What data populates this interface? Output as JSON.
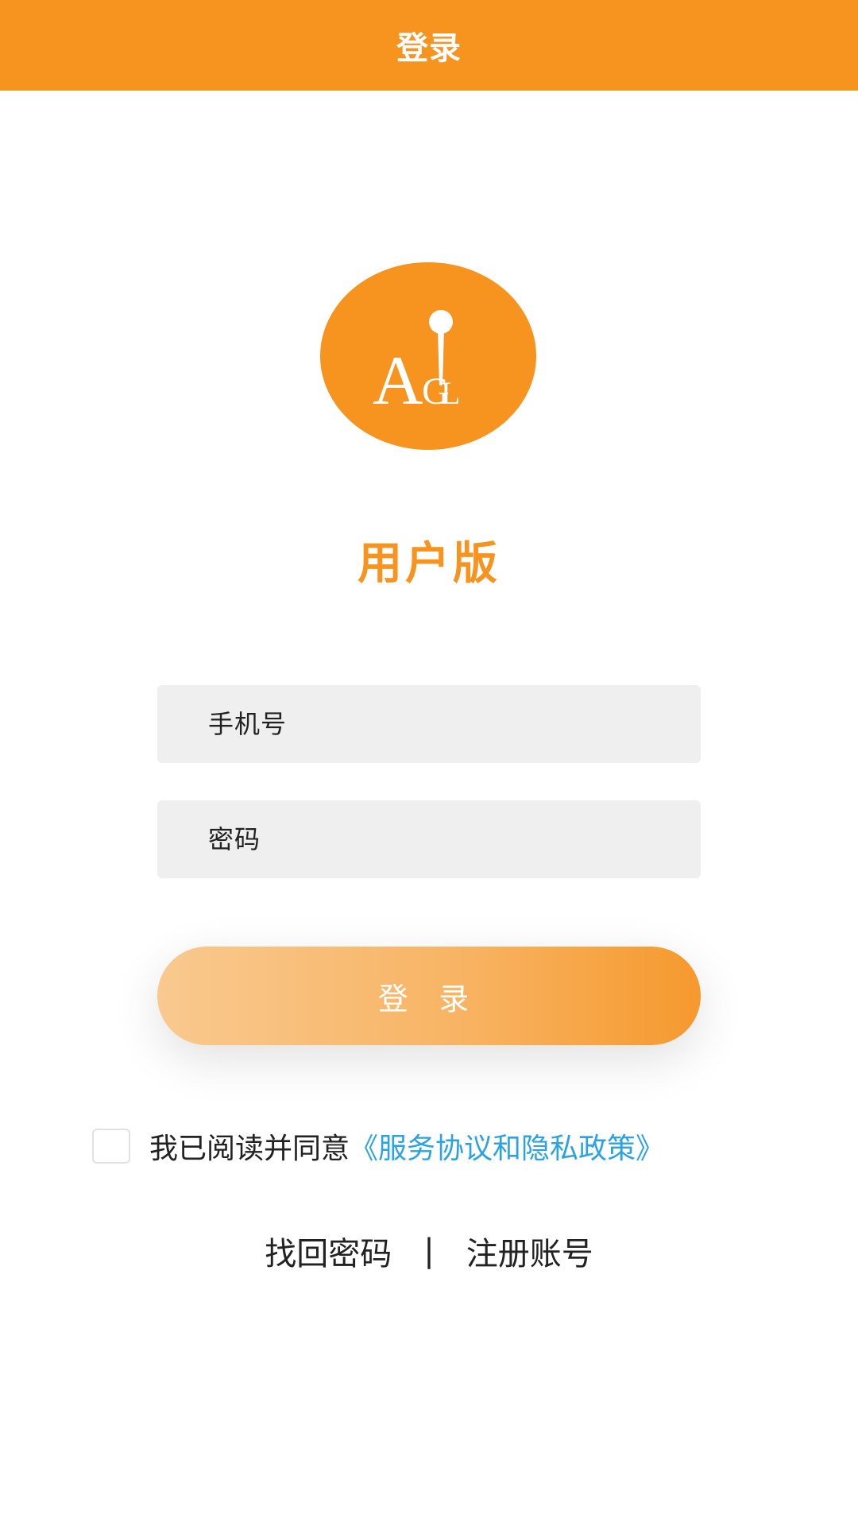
{
  "header": {
    "title": "登录"
  },
  "logo": {
    "letters": [
      "A",
      "G",
      "L"
    ],
    "color": "#f7931f"
  },
  "subtitle": "用户版",
  "form": {
    "phone_placeholder": "手机号",
    "password_placeholder": "密码",
    "login_label": "登 录"
  },
  "agreement": {
    "text": "我已阅读并同意",
    "link": "《服务协议和隐私政策》",
    "checked": false
  },
  "links": {
    "forgot_password": "找回密码",
    "separator": "|",
    "register": "注册账号"
  },
  "colors": {
    "accent": "#f7931f",
    "link": "#2aa3e6",
    "input_bg": "#efefef"
  }
}
